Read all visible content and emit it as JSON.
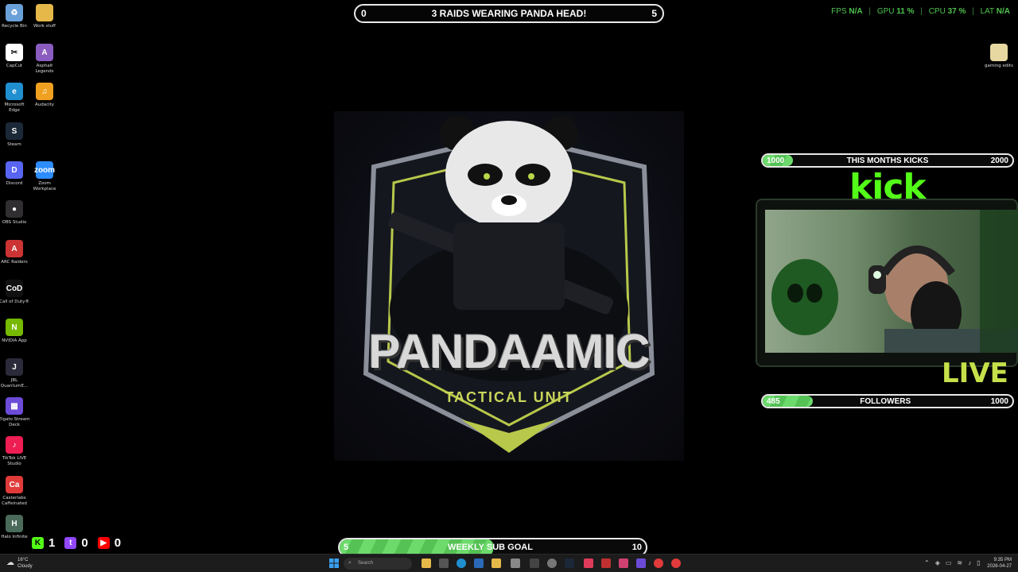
{
  "desktop": {
    "left_icons": [
      {
        "label": "Recycle Bin",
        "icon": "recycle-bin-icon",
        "color": "#6aa0d8",
        "glyph": "♻"
      },
      {
        "label": "Work stuff",
        "icon": "folder-icon",
        "color": "#e6b84a",
        "glyph": ""
      },
      {
        "label": "CapCut",
        "icon": "capcut-icon",
        "color": "#ffffff",
        "glyph": "✂"
      },
      {
        "label": "Asphalt Legends",
        "icon": "asphalt-icon",
        "color": "#8a5cc0",
        "glyph": "A"
      },
      {
        "label": "Microsoft Edge",
        "icon": "edge-icon",
        "color": "#1f8fd0",
        "glyph": "e"
      },
      {
        "label": "Audacity",
        "icon": "audacity-icon",
        "color": "#f0a020",
        "glyph": "♫"
      },
      {
        "label": "Steam",
        "icon": "steam-icon",
        "color": "#1b2838",
        "glyph": "S"
      },
      {
        "label": "Discord",
        "icon": "discord-icon",
        "color": "#5865f2",
        "glyph": "D"
      },
      {
        "label": "Zoom Workplace",
        "icon": "zoom-icon",
        "color": "#2d8cff",
        "glyph": "zoom"
      },
      {
        "label": "OBS Studio",
        "icon": "obs-icon",
        "color": "#302e31",
        "glyph": "●"
      },
      {
        "label": "ARC Raiders",
        "icon": "arc-raiders-icon",
        "color": "#c33",
        "glyph": "A"
      },
      {
        "label": "Call of Duty®",
        "icon": "call-of-duty-icon",
        "color": "#111",
        "glyph": "CoD"
      },
      {
        "label": "NVIDIA App",
        "icon": "nvidia-icon",
        "color": "#76b900",
        "glyph": "N"
      },
      {
        "label": "JBL QuantumE...",
        "icon": "jbl-icon",
        "color": "#2a2a3a",
        "glyph": "J"
      },
      {
        "label": "Elgato Stream Deck",
        "icon": "stream-deck-icon",
        "color": "#6c4bd8",
        "glyph": "▦"
      },
      {
        "label": "TikTok LIVE Studio",
        "icon": "tiktok-icon",
        "color": "#ee1d52",
        "glyph": "♪"
      },
      {
        "label": "Casterlabs Caffeinated",
        "icon": "casterlabs-icon",
        "color": "#e03a3a",
        "glyph": "Ca"
      },
      {
        "label": "Halo Infinite",
        "icon": "halo-icon",
        "color": "#4a6a5a",
        "glyph": "H"
      }
    ],
    "right_icon": {
      "label": "gaming edits",
      "icon": "folder-icon",
      "color": "#e6d8a0"
    }
  },
  "raid_goal": {
    "left": "0",
    "title": "3 RAIDS WEARING PANDA HEAD!",
    "right": "5"
  },
  "stats": {
    "fps_label": "FPS",
    "fps_value": "N/A",
    "gpu_label": "GPU",
    "gpu_value": "11 %",
    "cpu_label": "CPU",
    "cpu_value": "37 %",
    "lat_label": "LAT",
    "lat_value": "N/A"
  },
  "logo": {
    "title": "PANDAAMIC",
    "subtitle": "TACTICAL UNIT"
  },
  "kicks_goal": {
    "left": "1000",
    "title": "THIS MONTHS KICKS",
    "right": "2000",
    "progress": 0.12
  },
  "kick_brand": "kick",
  "live_label": "LIVE",
  "followers_goal": {
    "left": "485",
    "title": "FOLLOWERS",
    "right": "1000",
    "progress": 0.2
  },
  "sub_goal": {
    "left": "5",
    "title": "WEEKLY SUB GOAL",
    "right": "10",
    "progress": 0.5
  },
  "social": {
    "kick_count": "1",
    "twitch_count": "0",
    "youtube_count": "0"
  },
  "taskbar": {
    "weather_temp": "16°C",
    "weather_desc": "Cloudy",
    "search_placeholder": "Search",
    "time": "9:35 PM",
    "date": "2026-04-27"
  },
  "colors": {
    "accent_green": "#53fc18",
    "stats_green": "#4fc24f",
    "live_yellow": "#c6e04a"
  }
}
